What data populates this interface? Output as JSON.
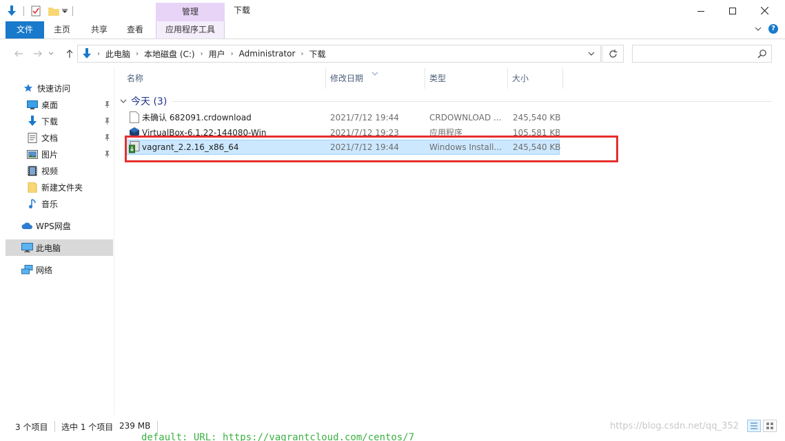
{
  "window": {
    "title": "下载",
    "context_tab": "管理",
    "controls": {
      "minimize": "—",
      "maximize": "☐",
      "close": "✕"
    }
  },
  "ribbon": {
    "tabs": [
      "文件",
      "主页",
      "共享",
      "查看",
      "应用程序工具"
    ],
    "file_tab_color": "#1979ca",
    "help": "?"
  },
  "address": {
    "crumbs": [
      "此电脑",
      "本地磁盘 (C:)",
      "用户",
      "Administrator",
      "下载"
    ],
    "search_placeholder": ""
  },
  "nav": {
    "items": [
      {
        "label": "快速访问",
        "icon": "star-icon"
      },
      {
        "label": "桌面",
        "icon": "desktop-icon",
        "pinned": true
      },
      {
        "label": "下载",
        "icon": "download-arrow-icon",
        "pinned": true
      },
      {
        "label": "文档",
        "icon": "document-icon",
        "pinned": true
      },
      {
        "label": "图片",
        "icon": "picture-icon",
        "pinned": true
      },
      {
        "label": "视频",
        "icon": "video-icon"
      },
      {
        "label": "新建文件夹",
        "icon": "folder-icon"
      },
      {
        "label": "音乐",
        "icon": "music-icon"
      },
      {
        "label": "WPS网盘",
        "icon": "cloud-icon"
      },
      {
        "label": "此电脑",
        "icon": "computer-icon",
        "selected": true
      },
      {
        "label": "网络",
        "icon": "network-icon"
      }
    ]
  },
  "columns": [
    "名称",
    "修改日期",
    "类型",
    "大小"
  ],
  "group": {
    "label": "今天 (3)"
  },
  "files": [
    {
      "name": "未确认 682091.crdownload",
      "date": "2021/7/12 19:44",
      "type": "CRDOWNLOAD ...",
      "size": "245,540 KB",
      "icon": "blank-file-icon"
    },
    {
      "name": "VirtualBox-6.1.22-144080-Win",
      "date": "2021/7/12 19:23",
      "type": "应用程序",
      "size": "105,581 KB",
      "icon": "virtualbox-icon"
    },
    {
      "name": "vagrant_2.2.16_x86_64",
      "date": "2021/7/12 19:44",
      "type": "Windows Install...",
      "size": "245,540 KB",
      "icon": "msi-installer-icon",
      "selected": true
    }
  ],
  "status": {
    "count": "3 个项目",
    "selected": "选中 1 个项目",
    "size": "239 MB"
  },
  "background_terminal": "default: URL: https://vagrantcloud.com/centos/7",
  "watermark": "https://blog.csdn.net/qq_352"
}
